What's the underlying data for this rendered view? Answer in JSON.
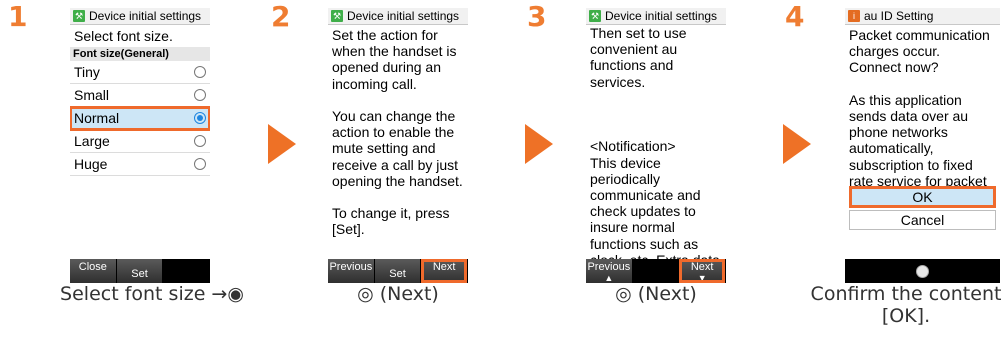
{
  "steps": [
    {
      "number": "1",
      "title": "Device initial settings",
      "heading": "Select font size.",
      "section": "Font size(General)",
      "options": [
        "Tiny",
        "Small",
        "Normal",
        "Large",
        "Huge"
      ],
      "selected_option": "Normal",
      "softkeys": {
        "left": "Close",
        "center": "Set"
      },
      "caption": "Select font size →◉"
    },
    {
      "number": "2",
      "title": "Device initial settings",
      "body": "Set the action for when the handset is opened during an incoming call.\n\nYou can change the action to enable the mute setting and receive a call by just opening the handset.\n\nTo change it, press [Set].",
      "softkeys": {
        "left": "Previous",
        "center": "Set",
        "right": "Next"
      },
      "caption": "◎ (Next)"
    },
    {
      "number": "3",
      "title": "Device initial settings",
      "body": "Then set to use convenient au functions and services.\n\n\n\n<Notification>\nThis device periodically communicate and check updates to insure normal functions such as clock, etc. Extra data communication charges will be incurred.",
      "softkeys": {
        "left": "Previous",
        "right": "Next"
      },
      "caption": "◎ (Next)"
    },
    {
      "number": "4",
      "title": "au ID Setting",
      "body": "Packet communication charges occur.\nConnect now?\n\nAs this application sends data over au phone networks automatically, subscription to fixed rate service for packet transmission is strongly",
      "ok_label": "OK",
      "cancel_label": "Cancel",
      "caption": "Confirm the content\n[OK]."
    }
  ],
  "colors": {
    "accent": "#ef6a2c",
    "arrow": "#ee7126",
    "selected_bg": "#cde6f6",
    "radio": "#1f86e0"
  },
  "icons": {
    "settings": "wrench-icon",
    "au_id": "au-id-icon",
    "arrow": "triangle-right-icon"
  }
}
